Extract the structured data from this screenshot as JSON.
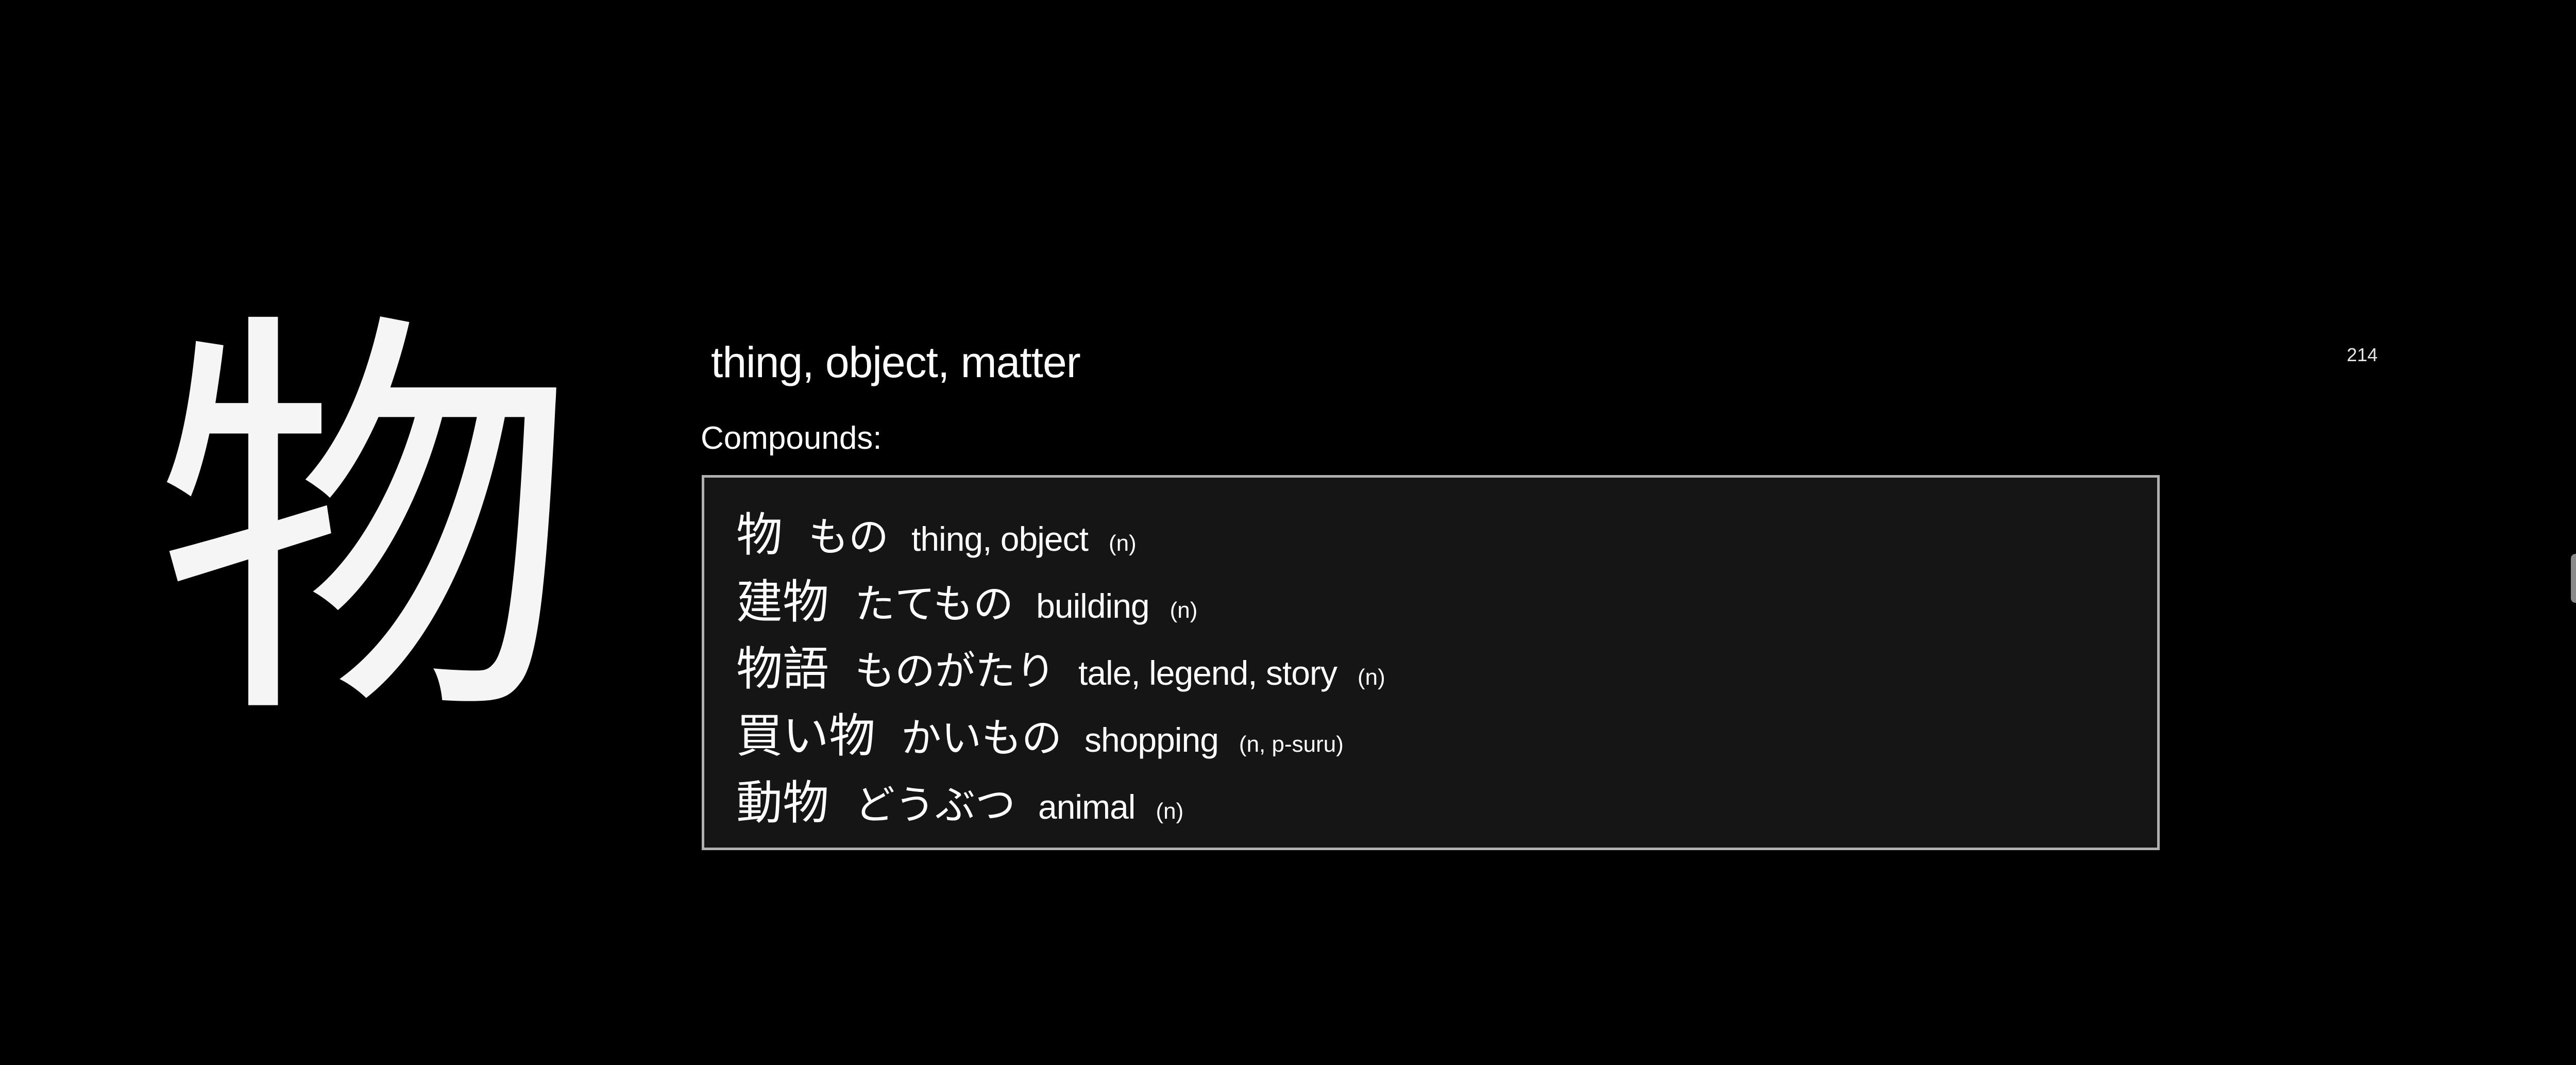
{
  "kanji": "物",
  "meaning": "thing, object, matter",
  "frame_number": "214",
  "compounds_label": "Compounds:",
  "compounds": [
    {
      "word": "物",
      "reading": "もの",
      "meaning": "thing, object",
      "pos": "(n)"
    },
    {
      "word": "建物",
      "reading": "たてもの",
      "meaning": "building",
      "pos": "(n)"
    },
    {
      "word": "物語",
      "reading": "ものがたり",
      "meaning": "tale, legend, story",
      "pos": "(n)"
    },
    {
      "word": "買い物",
      "reading": "かいもの",
      "meaning": "shopping",
      "pos": "(n, p-suru)"
    },
    {
      "word": "動物",
      "reading": "どうぶつ",
      "meaning": "animal",
      "pos": "(n)"
    }
  ],
  "colors": {
    "background": "#000000",
    "text": "#ffffff",
    "box_background": "#151515",
    "box_border": "#b0b0b0"
  }
}
